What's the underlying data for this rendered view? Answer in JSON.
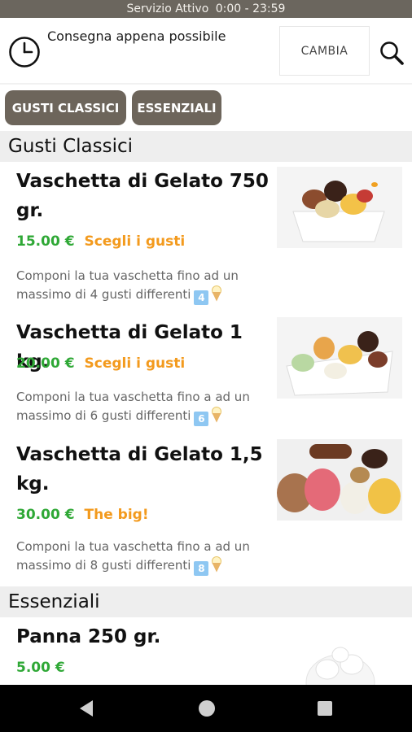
{
  "status_bar": {
    "label": "Servizio Attivo",
    "hours": "0:00 - 23:59"
  },
  "delivery": {
    "text": "Consegna appena possibile",
    "change_label": "CAMBIA"
  },
  "categories": [
    "GUSTI CLASSICI",
    "ESSENZIALI"
  ],
  "sections": [
    {
      "title": "Gusti Classici",
      "products": [
        {
          "title": "Vaschetta di Gelato 750 gr.",
          "price": "15.00 €",
          "tag": "Scegli i gusti",
          "description": "Componi la tua vaschetta fino ad un massimo di 4 gusti differenti",
          "badge": "4"
        },
        {
          "title": "Vaschetta di Gelato 1 kg.",
          "price": "20.00 €",
          "tag": "Scegli i gusti",
          "description": "Componi la tua vaschetta fino a ad un massimo di 6 gusti differenti",
          "badge": "6"
        },
        {
          "title": "Vaschetta di Gelato 1,5 kg.",
          "price": "30.00 €",
          "tag": "The big!",
          "description": "Componi la tua vaschetta fino a ad un massimo di 8 gusti differenti",
          "badge": "8"
        }
      ]
    },
    {
      "title": "Essenziali",
      "products": [
        {
          "title": "Panna 250 gr.",
          "price": "5.00 €"
        }
      ]
    }
  ],
  "colors": {
    "status_bar": "#6b665e",
    "category_button": "#6d655b",
    "price": "#2fa836",
    "tag": "#f39a1d",
    "section_header": "#eeeeee"
  },
  "icons": [
    "clock-icon",
    "search-icon",
    "ice-cream-icon",
    "back-icon",
    "home-icon",
    "recent-apps-icon"
  ]
}
